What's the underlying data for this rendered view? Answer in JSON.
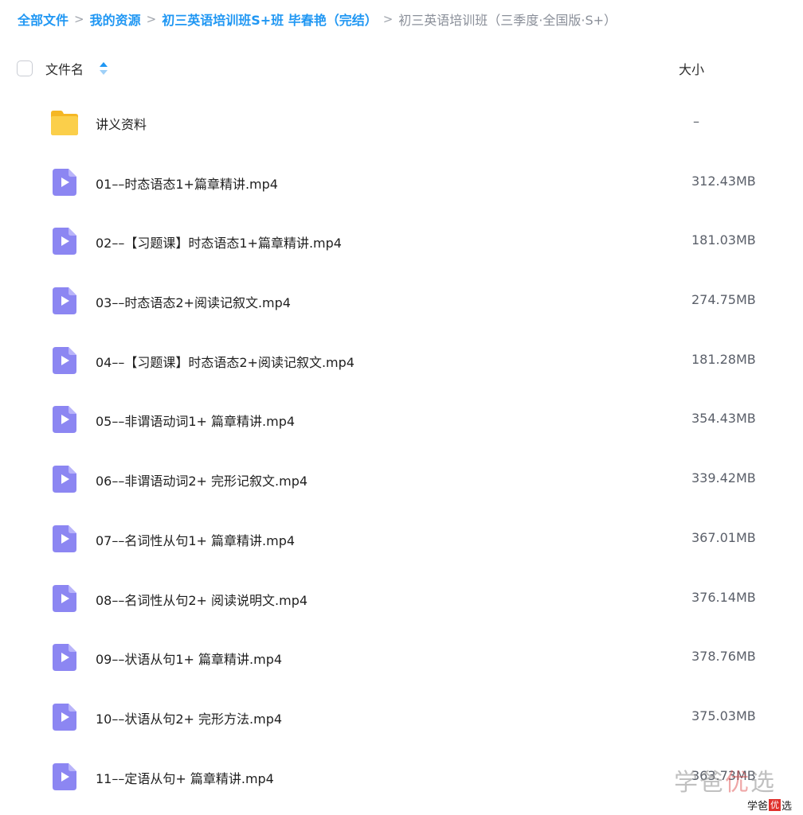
{
  "breadcrumb": [
    {
      "label": "全部文件",
      "current": false
    },
    {
      "label": "我的资源",
      "current": false
    },
    {
      "label": "初三英语培训班S+班 毕春艳（完结）",
      "current": false
    },
    {
      "label": "初三英语培训班（三季度·全国版·S+）",
      "current": true
    }
  ],
  "breadcrumb_separator": ">",
  "header": {
    "name_label": "文件名",
    "size_label": "大小"
  },
  "files": [
    {
      "name": "讲义资料",
      "size": "–",
      "type": "folder"
    },
    {
      "name": "01––时态语态1+篇章精讲.mp4",
      "size": "312.43MB",
      "type": "video"
    },
    {
      "name": "02––【习题课】时态语态1+篇章精讲.mp4",
      "size": "181.03MB",
      "type": "video"
    },
    {
      "name": "03––时态语态2+阅读记叙文.mp4",
      "size": "274.75MB",
      "type": "video"
    },
    {
      "name": "04––【习题课】时态语态2+阅读记叙文.mp4",
      "size": "181.28MB",
      "type": "video"
    },
    {
      "name": "05––非谓语动词1+ 篇章精讲.mp4",
      "size": "354.43MB",
      "type": "video"
    },
    {
      "name": "06––非谓语动词2+ 完形记叙文.mp4",
      "size": "339.42MB",
      "type": "video"
    },
    {
      "name": "07––名词性从句1+ 篇章精讲.mp4",
      "size": "367.01MB",
      "type": "video"
    },
    {
      "name": "08––名词性从句2+ 阅读说明文.mp4",
      "size": "376.14MB",
      "type": "video"
    },
    {
      "name": "09––状语从句1+ 篇章精讲.mp4",
      "size": "378.76MB",
      "type": "video"
    },
    {
      "name": "10––状语从句2+ 完形方法.mp4",
      "size": "375.03MB",
      "type": "video"
    },
    {
      "name": "11––定语从句+ 篇章精讲.mp4",
      "size": "363.73MB",
      "type": "video"
    }
  ],
  "watermark": {
    "big_prefix": "学爸",
    "big_highlight": "优",
    "big_suffix": "选",
    "small_prefix": "学爸",
    "small_highlight": "优",
    "small_suffix": "选"
  },
  "colors": {
    "link": "#2097f3",
    "folder": "#f9c33a",
    "video_icon": "#8c86f2"
  },
  "icons": {
    "folder": "folder-icon",
    "video": "video-file-icon",
    "sort": "sort-icon"
  }
}
